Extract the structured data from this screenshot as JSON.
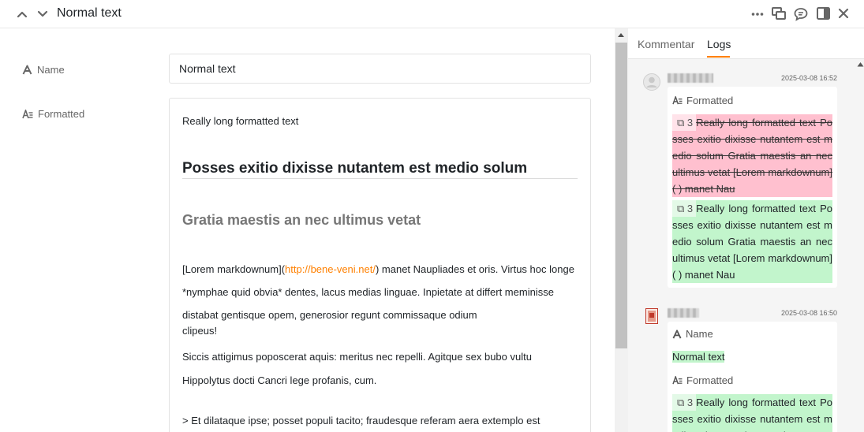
{
  "header": {
    "title": "Normal text",
    "icons": [
      "chevron-up-icon",
      "chevron-down-icon",
      "more-icon",
      "expand-icon",
      "comment-icon",
      "sidebar-icon",
      "close-icon"
    ]
  },
  "form": {
    "name_label": "Name",
    "name_value": "Normal text",
    "formatted_label": "Formatted",
    "formatted": {
      "paragraph1": "Really long formatted text",
      "heading1": "Posses exitio dixisse nutantem est medio solum",
      "heading2": "Gratia maestis an nec ultimus vetat",
      "link_prefix": "[Lorem markdownum](",
      "link_url": "http://bene-veni.net/",
      "link_suffix": ") manet Naupliades et oris. Virtus hoc longe *nymphae quid obvia* dentes, lacus medias linguae. Inpietate at differt meminisse distabat gentisque opem, generosior regunt commissaque odium",
      "link_last": "clipeus!",
      "paragraph3": "Siccis attigimus poposcerat aquis: meritus nec repelli. Agitque sex bubo vultu Hippolytus docti Cancri lege profanis, cum.",
      "quote": "> Et dilataque ipse; posset populi tacito; fraudesque referam aera extemplo est"
    }
  },
  "panel": {
    "tabs": [
      {
        "label": "Kommentar",
        "active": false
      },
      {
        "label": "Logs",
        "active": true
      }
    ],
    "accent": "#ff8000",
    "logs": [
      {
        "time": "2025-03-08 16:52",
        "field": "Formatted",
        "removed_count": "3",
        "removed_text": "Really long formatted text Posses exitio dixisse nutantem est medio solum Gratia maestis an nec ultimus vetat [Lorem markdownum]( ) manet Nau",
        "added_count": "3",
        "added_text": "Really long formatted text Posses exitio dixisse nutantem est medio solum Gratia maestis an nec ultimus vetat [Lorem markdownum]( ) manet Nau"
      },
      {
        "time": "2025-03-08 16:50",
        "field1": "Name",
        "value1": "Normal text",
        "field2": "Formatted",
        "added_count": "3",
        "added_text": "Really long formatted text Posses exitio dixisse nutantem est medio solum Gratia maestis an nec"
      }
    ]
  }
}
